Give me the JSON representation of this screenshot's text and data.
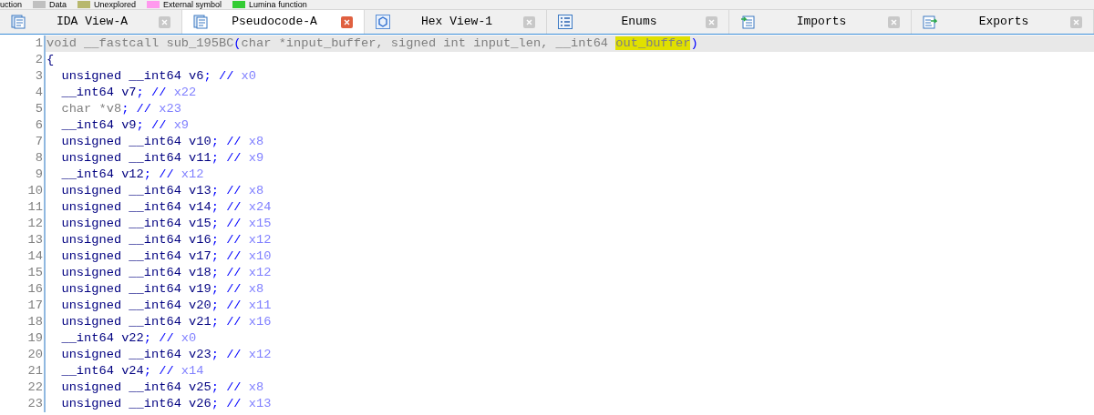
{
  "legend": [
    {
      "label": "uction",
      "kind": "cut"
    },
    {
      "label": "Data",
      "kind": "swatch",
      "color": "#c0c0c0"
    },
    {
      "label": "Unexplored",
      "kind": "swatch",
      "color": "#b8b86e"
    },
    {
      "label": "External symbol",
      "kind": "swatch",
      "color": "#ff99ee"
    },
    {
      "label": "Lumina function",
      "kind": "swatch",
      "color": "#33cc33"
    }
  ],
  "tabs": [
    {
      "label": "IDA View-A",
      "kind": "graph",
      "selected": false
    },
    {
      "label": "Pseudocode-A",
      "kind": "graph",
      "selected": true
    },
    {
      "label": "Hex View-1",
      "kind": "hex",
      "selected": false
    },
    {
      "label": "Enums",
      "kind": "list",
      "selected": false
    },
    {
      "label": "Imports",
      "kind": "import",
      "selected": false
    },
    {
      "label": "Exports",
      "kind": "export",
      "selected": false
    }
  ],
  "code": {
    "lines": [
      {
        "number": "1",
        "current": true,
        "segments": [
          {
            "text": "void __fastcall sub_195BC",
            "kind": "dim"
          },
          {
            "text": "(",
            "kind": "punct"
          },
          {
            "text": "char *input_buffer, signed int input_len, __int64 ",
            "kind": "dim"
          },
          {
            "text": "out_buffer",
            "kind": "mark"
          },
          {
            "text": ")",
            "kind": "punct"
          }
        ]
      },
      {
        "number": "2",
        "current": false,
        "segments": [
          {
            "text": "{",
            "kind": "plain"
          }
        ]
      },
      {
        "number": "3",
        "current": false,
        "segments": [
          {
            "text": "  unsigned __int64 v6",
            "kind": "plain"
          },
          {
            "text": "; // ",
            "kind": "punct"
          },
          {
            "text": "x0",
            "kind": "reg"
          }
        ]
      },
      {
        "number": "4",
        "current": false,
        "segments": [
          {
            "text": "  __int64 v7",
            "kind": "plain"
          },
          {
            "text": "; // ",
            "kind": "punct"
          },
          {
            "text": "x22",
            "kind": "reg"
          }
        ]
      },
      {
        "number": "5",
        "current": false,
        "segments": [
          {
            "text": "  char *v8",
            "kind": "dim"
          },
          {
            "text": "; // ",
            "kind": "punct"
          },
          {
            "text": "x23",
            "kind": "reg"
          }
        ]
      },
      {
        "number": "6",
        "current": false,
        "segments": [
          {
            "text": "  __int64 v9",
            "kind": "plain"
          },
          {
            "text": "; // ",
            "kind": "punct"
          },
          {
            "text": "x9",
            "kind": "reg"
          }
        ]
      },
      {
        "number": "7",
        "current": false,
        "segments": [
          {
            "text": "  unsigned __int64 v10",
            "kind": "plain"
          },
          {
            "text": "; // ",
            "kind": "punct"
          },
          {
            "text": "x8",
            "kind": "reg"
          }
        ]
      },
      {
        "number": "8",
        "current": false,
        "segments": [
          {
            "text": "  unsigned __int64 v11",
            "kind": "plain"
          },
          {
            "text": "; // ",
            "kind": "punct"
          },
          {
            "text": "x9",
            "kind": "reg"
          }
        ]
      },
      {
        "number": "9",
        "current": false,
        "segments": [
          {
            "text": "  __int64 v12",
            "kind": "plain"
          },
          {
            "text": "; // ",
            "kind": "punct"
          },
          {
            "text": "x12",
            "kind": "reg"
          }
        ]
      },
      {
        "number": "10",
        "current": false,
        "segments": [
          {
            "text": "  unsigned __int64 v13",
            "kind": "plain"
          },
          {
            "text": "; // ",
            "kind": "punct"
          },
          {
            "text": "x8",
            "kind": "reg"
          }
        ]
      },
      {
        "number": "11",
        "current": false,
        "segments": [
          {
            "text": "  unsigned __int64 v14",
            "kind": "plain"
          },
          {
            "text": "; // ",
            "kind": "punct"
          },
          {
            "text": "x24",
            "kind": "reg"
          }
        ]
      },
      {
        "number": "12",
        "current": false,
        "segments": [
          {
            "text": "  unsigned __int64 v15",
            "kind": "plain"
          },
          {
            "text": "; // ",
            "kind": "punct"
          },
          {
            "text": "x15",
            "kind": "reg"
          }
        ]
      },
      {
        "number": "13",
        "current": false,
        "segments": [
          {
            "text": "  unsigned __int64 v16",
            "kind": "plain"
          },
          {
            "text": "; // ",
            "kind": "punct"
          },
          {
            "text": "x12",
            "kind": "reg"
          }
        ]
      },
      {
        "number": "14",
        "current": false,
        "segments": [
          {
            "text": "  unsigned __int64 v17",
            "kind": "plain"
          },
          {
            "text": "; // ",
            "kind": "punct"
          },
          {
            "text": "x10",
            "kind": "reg"
          }
        ]
      },
      {
        "number": "15",
        "current": false,
        "segments": [
          {
            "text": "  unsigned __int64 v18",
            "kind": "plain"
          },
          {
            "text": "; // ",
            "kind": "punct"
          },
          {
            "text": "x12",
            "kind": "reg"
          }
        ]
      },
      {
        "number": "16",
        "current": false,
        "segments": [
          {
            "text": "  unsigned __int64 v19",
            "kind": "plain"
          },
          {
            "text": "; // ",
            "kind": "punct"
          },
          {
            "text": "x8",
            "kind": "reg"
          }
        ]
      },
      {
        "number": "17",
        "current": false,
        "segments": [
          {
            "text": "  unsigned __int64 v20",
            "kind": "plain"
          },
          {
            "text": "; // ",
            "kind": "punct"
          },
          {
            "text": "x11",
            "kind": "reg"
          }
        ]
      },
      {
        "number": "18",
        "current": false,
        "segments": [
          {
            "text": "  unsigned __int64 v21",
            "kind": "plain"
          },
          {
            "text": "; // ",
            "kind": "punct"
          },
          {
            "text": "x16",
            "kind": "reg"
          }
        ]
      },
      {
        "number": "19",
        "current": false,
        "segments": [
          {
            "text": "  __int64 v22",
            "kind": "plain"
          },
          {
            "text": "; // ",
            "kind": "punct"
          },
          {
            "text": "x0",
            "kind": "reg"
          }
        ]
      },
      {
        "number": "20",
        "current": false,
        "segments": [
          {
            "text": "  unsigned __int64 v23",
            "kind": "plain"
          },
          {
            "text": "; // ",
            "kind": "punct"
          },
          {
            "text": "x12",
            "kind": "reg"
          }
        ]
      },
      {
        "number": "21",
        "current": false,
        "segments": [
          {
            "text": "  __int64 v24",
            "kind": "plain"
          },
          {
            "text": "; // ",
            "kind": "punct"
          },
          {
            "text": "x14",
            "kind": "reg"
          }
        ]
      },
      {
        "number": "22",
        "current": false,
        "segments": [
          {
            "text": "  unsigned __int64 v25",
            "kind": "plain"
          },
          {
            "text": "; // ",
            "kind": "punct"
          },
          {
            "text": "x8",
            "kind": "reg"
          }
        ]
      },
      {
        "number": "23",
        "current": false,
        "segments": [
          {
            "text": "  unsigned __int64 v26",
            "kind": "plain"
          },
          {
            "text": "; // ",
            "kind": "punct"
          },
          {
            "text": "x13",
            "kind": "reg"
          }
        ]
      }
    ]
  }
}
